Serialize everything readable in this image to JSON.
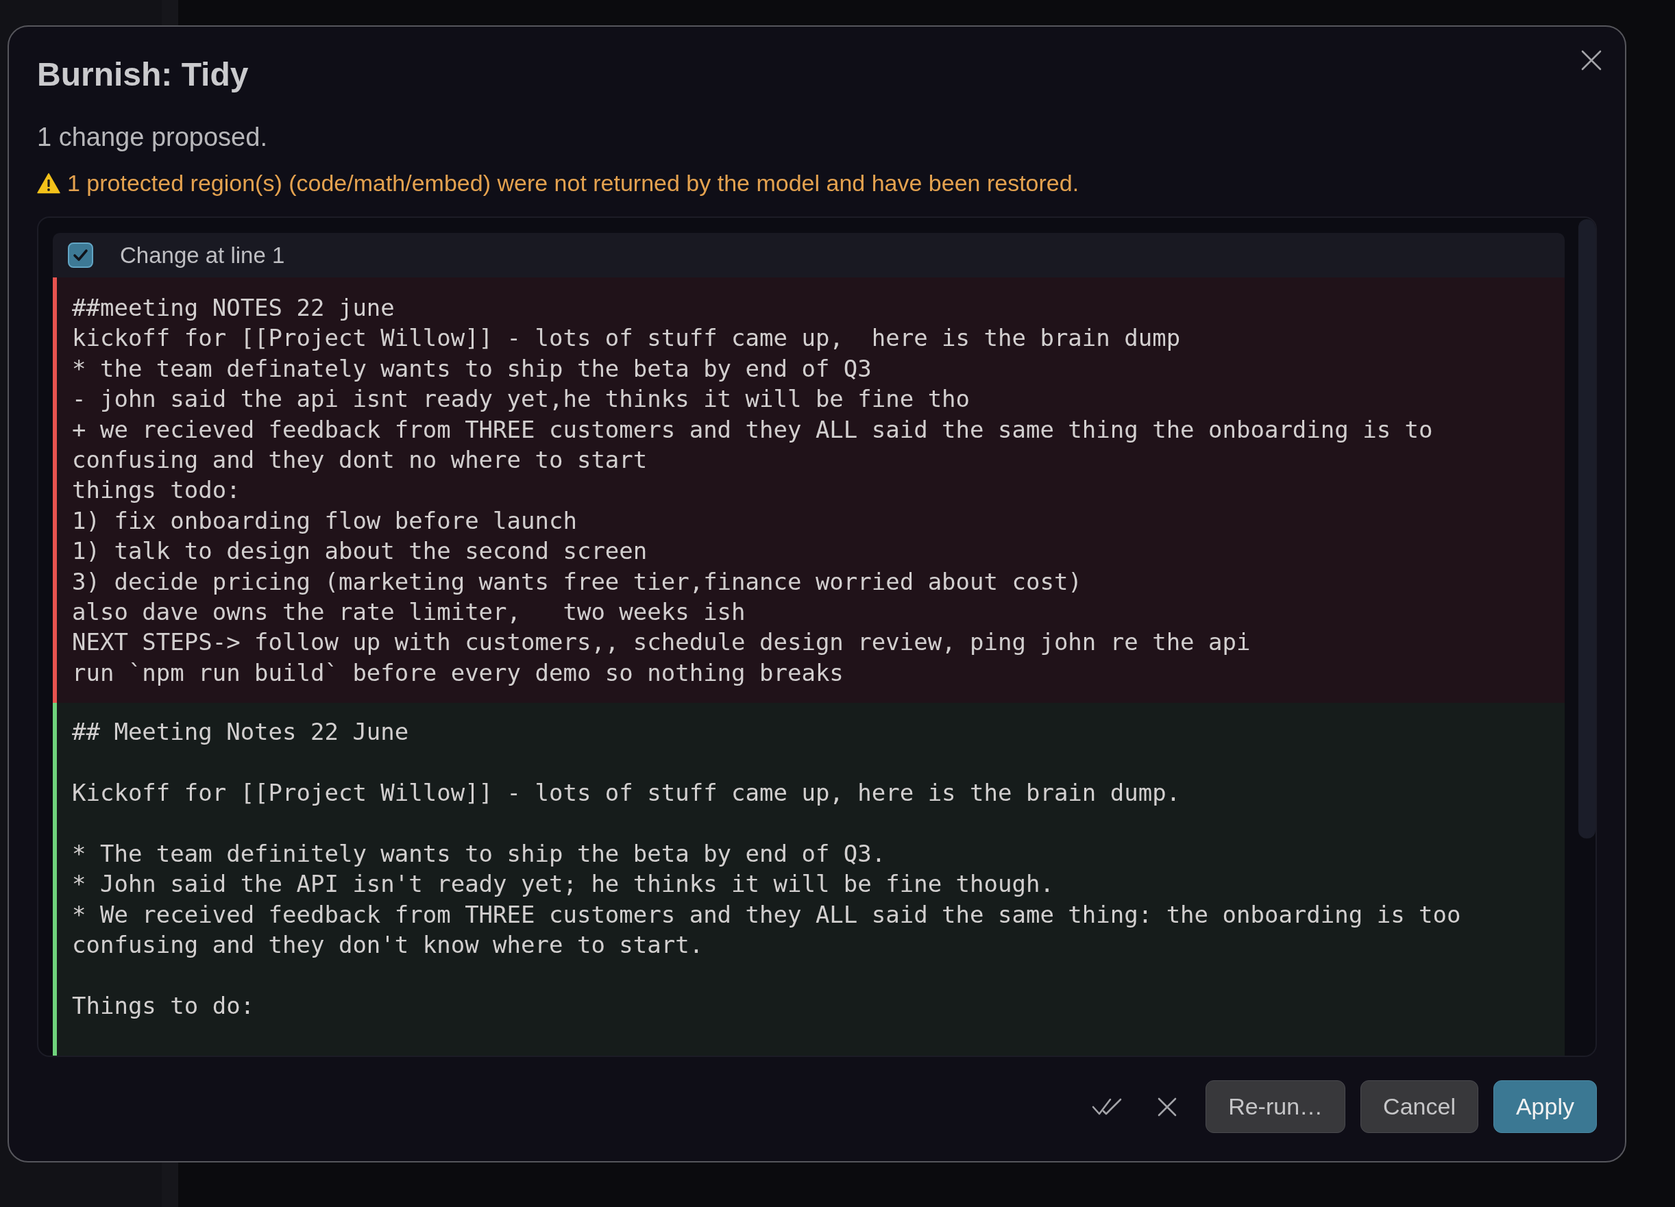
{
  "dialog": {
    "title": "Burnish: Tidy",
    "summary": "1 change proposed.",
    "warning": "1 protected region(s) (code/math/embed) were not returned by the model and have been restored."
  },
  "changes": [
    {
      "label": "Change at line 1",
      "checked": true,
      "hunks": [
        {
          "kind": "removed",
          "text": "##meeting NOTES 22 june\nkickoff for [[Project Willow]] - lots of stuff came up,  here is the brain dump\n* the team definately wants to ship the beta by end of Q3\n- john said the api isnt ready yet,he thinks it will be fine tho\n+ we recieved feedback from THREE customers and they ALL said the same thing the onboarding is to confusing and they dont no where to start\nthings todo:\n1) fix onboarding flow before launch\n1) talk to design about the second screen\n3) decide pricing (marketing wants free tier,finance worried about cost)\nalso dave owns the rate limiter,   two weeks ish\nNEXT STEPS-> follow up with customers,, schedule design review, ping john re the api\nrun `npm run build` before every demo so nothing breaks"
        },
        {
          "kind": "added",
          "text": "## Meeting Notes 22 June\n\nKickoff for [[Project Willow]] - lots of stuff came up, here is the brain dump.\n\n* The team definitely wants to ship the beta by end of Q3.\n* John said the API isn't ready yet; he thinks it will be fine though.\n* We received feedback from THREE customers and they ALL said the same thing: the onboarding is too confusing and they don't know where to start.\n\nThings to do:"
        }
      ]
    }
  ],
  "buttons": [
    {
      "label": "Re-run…",
      "kind": "secondary"
    },
    {
      "label": "Cancel",
      "kind": "secondary"
    },
    {
      "label": "Apply",
      "kind": "primary"
    }
  ]
}
